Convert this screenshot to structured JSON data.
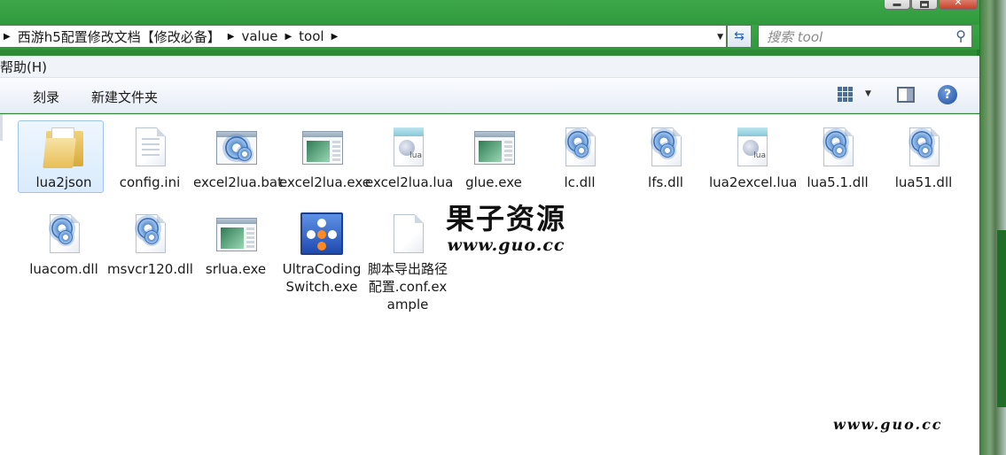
{
  "address_bar": {
    "breadcrumbs": [
      "西游h5配置修改文档【修改必备】",
      "value",
      "tool"
    ]
  },
  "search": {
    "placeholder": "搜索 tool"
  },
  "menu": {
    "help": "帮助(H)"
  },
  "toolbar": {
    "burn": "刻录",
    "new_folder": "新建文件夹"
  },
  "files": [
    {
      "name": "lua2json",
      "type": "folder"
    },
    {
      "name": "config.ini",
      "type": "ini"
    },
    {
      "name": "excel2lua.bat",
      "type": "bat"
    },
    {
      "name": "excel2lua.exe",
      "type": "exe"
    },
    {
      "name": "excel2lua.lua",
      "type": "lua"
    },
    {
      "name": "glue.exe",
      "type": "exe"
    },
    {
      "name": "lc.dll",
      "type": "dll"
    },
    {
      "name": "lfs.dll",
      "type": "dll"
    },
    {
      "name": "lua2excel.lua",
      "type": "lua"
    },
    {
      "name": "lua5.1.dll",
      "type": "dll"
    },
    {
      "name": "lua51.dll",
      "type": "dll"
    },
    {
      "name": "luacom.dll",
      "type": "dll"
    },
    {
      "name": "msvcr120.dll",
      "type": "dll"
    },
    {
      "name": "srlua.exe",
      "type": "exe"
    },
    {
      "name": "UltraCodingSwitch.exe",
      "type": "app"
    },
    {
      "name": "脚本导出路径配置.conf.example",
      "type": "file"
    }
  ],
  "watermark": {
    "title": "果子资源",
    "url": "www.guo.cc",
    "corner_url": "www.guo.cc"
  },
  "icons": {
    "refresh": "refresh-icon",
    "search": "search-icon",
    "help": "help-icon",
    "views": "view-grid-icon",
    "preview_pane": "preview-pane-icon"
  }
}
